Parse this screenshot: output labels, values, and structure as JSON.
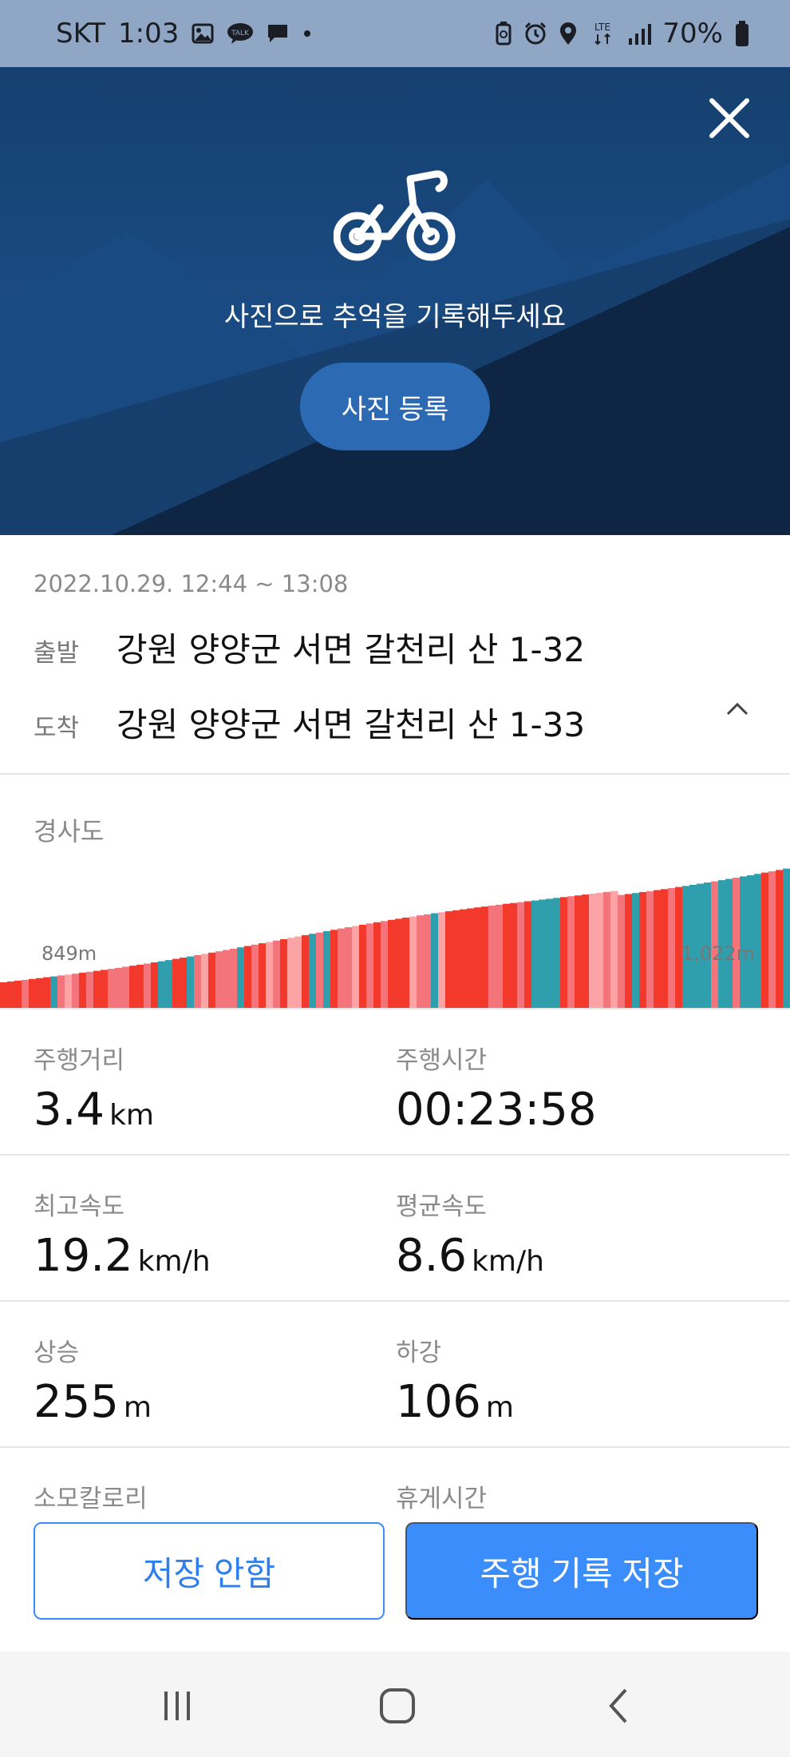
{
  "status_bar": {
    "carrier": "SKT",
    "time": "1:03",
    "network": "LTE",
    "battery": "70%",
    "left_icons": [
      "gallery-icon",
      "kakaotalk-icon",
      "message-icon",
      "dot-icon"
    ],
    "right_icons": [
      "battery-saver-icon",
      "alarm-icon",
      "location-icon",
      "lte-icon",
      "signal-icon",
      "battery-icon"
    ]
  },
  "hero": {
    "message": "사진으로 추억을 기록해두세요",
    "photo_button": "사진 등록",
    "icon": "bicycle-icon",
    "colors": {
      "sky": "#1d4f88",
      "mountain": "#0f2544"
    }
  },
  "ride": {
    "datetime": "2022.10.29. 12:44 ~ 13:08",
    "start_label": "출발",
    "start_value": "강원 양양군 서면 갈천리 산 1-32",
    "end_label": "도착",
    "end_value": "강원 양양군 서면 갈천리 산 1-33"
  },
  "elevation": {
    "title": "경사도",
    "min_label": "849m",
    "max_label": "1,022m",
    "colors": {
      "steep": "#f2392b",
      "moderate": "#f3747a",
      "light": "#fba3a5",
      "flat": "#2f9fae"
    }
  },
  "stats": [
    {
      "label": "주행거리",
      "value": "3.4",
      "unit": "km"
    },
    {
      "label": "주행시간",
      "value": "00:23:58",
      "unit": ""
    },
    {
      "label": "최고속도",
      "value": "19.2",
      "unit": "km/h"
    },
    {
      "label": "평균속도",
      "value": "8.6",
      "unit": "km/h"
    },
    {
      "label": "상승",
      "value": "255",
      "unit": "m"
    },
    {
      "label": "하강",
      "value": "106",
      "unit": "m"
    },
    {
      "label": "소모칼로리",
      "value": "",
      "unit": ""
    },
    {
      "label": "휴게시간",
      "value": "",
      "unit": ""
    }
  ],
  "actions": {
    "cancel": "저장 안함",
    "save": "주행 기록 저장",
    "accent": "#3a8dfb"
  },
  "nav": {
    "recent": "recent-apps-icon",
    "home": "home-icon",
    "back": "back-icon"
  }
}
